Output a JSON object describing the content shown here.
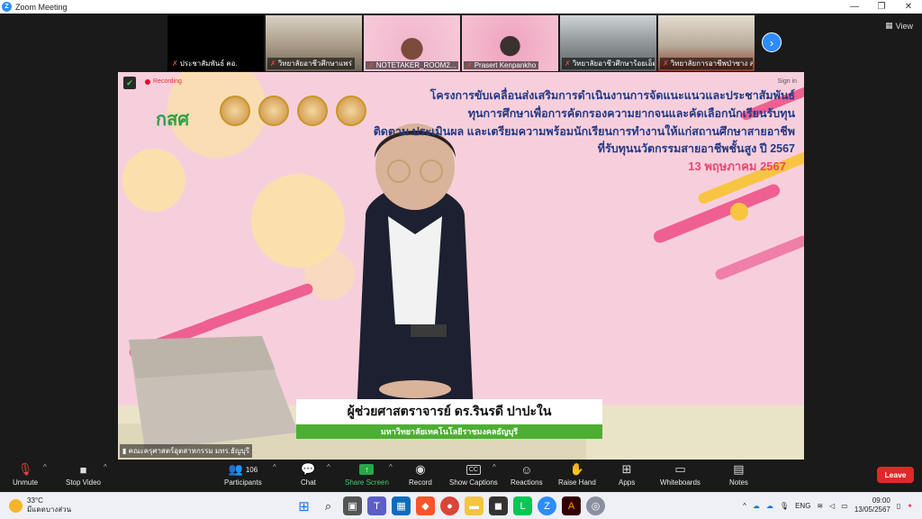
{
  "window": {
    "title": "Zoom Meeting",
    "minimize": "—",
    "maximize": "❐",
    "close": "✕"
  },
  "view_button": {
    "label": "View"
  },
  "thumbnails": [
    {
      "name": "ประชาสัมพันธ์ คอ.",
      "bg": "#000000"
    },
    {
      "name": "วิทยาลัยอาชีวศึกษาแพร่",
      "bg": "#b7a58c"
    },
    {
      "name": "NOTETAKER_ROOM2...",
      "bg": "#f2b8cf"
    },
    {
      "name": "Prasert Kenpankho",
      "bg": "#f0a8c2"
    },
    {
      "name": "วิทยาลัยอาชีวศึกษาร้อยเอ็ด",
      "bg": "#9fa6a8"
    },
    {
      "name": "วิทยาลัยการอาชีพป่าซาง ล...",
      "bg": "#c9c0b2"
    }
  ],
  "main": {
    "recording": "Recording",
    "signin": "Sign in",
    "logo": "กสศ",
    "banner_lines": [
      "โครงการขับเคลื่อนส่งเสริมการดำเนินงานการจัดแนะแนวและประชาสัมพันธ์",
      "ทุนการศึกษาเพื่อการคัดกรองความยากจนและคัดเลือกนักเรียนรับทุน",
      "ติดตาม ประเมินผล และเตรียมความพร้อมนักเรียนการทำงานให้แก่สถานศึกษาสายอาชีพ",
      "ที่รับทุนนวัตกรรมสายอาชีพชั้นสูง ปี 2567"
    ],
    "date": "13 พฤษภาคม 2567",
    "speaker_name": "ผู้ช่วยศาสตราจารย์ ดร.รินรดี ปาปะใน",
    "speaker_org": "มหาวิทยาลัยเทคโนโลยีราชมงคลธัญบุรี",
    "video_label": "คณะครุศาสตร์อุตสาหกรรม มทร.ธัญบุรี"
  },
  "controls": {
    "unmute": "Unmute",
    "stop_video": "Stop Video",
    "participants": "Participants",
    "participants_count": "106",
    "chat": "Chat",
    "share_screen": "Share Screen",
    "record": "Record",
    "show_captions": "Show Captions",
    "cc": "CC",
    "reactions": "Reactions",
    "raise_hand": "Raise Hand",
    "apps": "Apps",
    "whiteboards": "Whiteboards",
    "notes": "Notes",
    "leave": "Leave"
  },
  "taskbar": {
    "temp": "33°C",
    "weather_desc": "มีแดดบางส่วน",
    "lang": "ENG",
    "time": "09:00",
    "date": "13/05/2567"
  },
  "colors": {
    "accent": "#2d8cff",
    "leave": "#e02828",
    "share": "#25a748",
    "banner_text": "#233a85",
    "date_text": "#e8486f"
  }
}
